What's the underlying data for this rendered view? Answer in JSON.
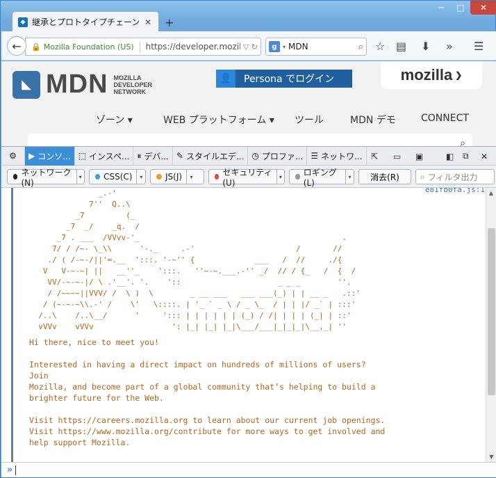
{
  "browser": {
    "tab_title": "継承とプロトタイプチェーン - J...",
    "new_tab": "+",
    "window_min": "─",
    "window_max": "□",
    "window_close": "✕",
    "identity": "Mozilla Foundation (US)",
    "url": "https://developer.mozil",
    "search_engine": "g",
    "search_value": "MDN"
  },
  "page": {
    "logo_text": "MDN",
    "logo_sub": [
      "MOZILLA",
      "DEVELOPER",
      "NETWORK"
    ],
    "persona_label": "Persona でログイン",
    "mozilla_label": "mozilla",
    "menu": [
      "ゾーン ▾",
      "WEB プラットフォーム ▾",
      "ツール",
      "MDN デモ",
      "CONNECT"
    ]
  },
  "devtools": {
    "tabs": [
      {
        "icon": "console-icon",
        "glyph": "▶",
        "label": "コンソ..."
      },
      {
        "icon": "inspector-icon",
        "glyph": "⬚",
        "label": "インスペ..."
      },
      {
        "icon": "debugger-icon",
        "glyph": "⏸",
        "label": "デバ..."
      },
      {
        "icon": "style-editor-icon",
        "glyph": "✎",
        "label": "スタイルエデ..."
      },
      {
        "icon": "profiler-icon",
        "glyph": "◷",
        "label": "プロファ..."
      },
      {
        "icon": "network-icon",
        "glyph": "☰",
        "label": "ネットワ..."
      }
    ],
    "filters": [
      {
        "label": "ネットワーク(N)",
        "color": "#222222"
      },
      {
        "label": "CSS(C)",
        "color": "#3aa0e0"
      },
      {
        "label": "JS(J)",
        "color": "#f0a020"
      },
      {
        "label": "セキュリティ(U)",
        "color": "#e04545"
      },
      {
        "label": "ロギング(L)",
        "color": "#999999"
      }
    ],
    "clear_label": "消去(R)",
    "filter_placeholder": "フィルタ出力"
  },
  "console": {
    "source_link": "e81fb0fa.js:1",
    "ascii_art": [
      "               _.-'",
      "             7''  Q..\\",
      "          _7         (_",
      "        _7  _/    _q.  /",
      "      _7 . ___  /VVvv-'_                                            .",
      "     7/ / /~- \\_\\\\      '-._     .-'                      /       //",
      "    ./ ( /-~-/||'=.__  ':::. '-~'' {             ___   /  //     ./{",
      "   V   V-~-~| ||   __''_    ':::.   ''~-~.___.-'' _/  // / {_   /  {  /",
      "    VV/-~-~-|/ \\ .'__'. '.    '::                     _ _ _        ''.",
      "    / /~~~~||VVV/ /  \\ )  \\        _ __ ___   ___ ___(_) | | __ _   .::'",
      "   / (~-~-~\\\\.-' /    \\'   \\::::. | '_ ` _ \\ / _ \\_  / | | |/ _` | :::'",
      "  /..\\    /..\\__/      '     '::: | | | | | | (_) / /| | | | (_| | ::'",
      "  vVVv    vVVv                 ': |_| |_| |_|\\___/___|_|_|_|\\__,_| ''"
    ],
    "messages": [
      "Hi there, nice to meet you!",
      "",
      "Interested in having a direct impact on hundreds of millions of users?",
      "Join",
      "Mozilla, and become part of a global community that’s helping to build a",
      "brighter future for the Web.",
      "",
      "Visit https://careers.mozilla.org to learn about our current job openings.",
      "Visit https://www.mozilla.org/contribute for more ways to get involved and",
      "help support Mozilla."
    ],
    "prompt": "»"
  }
}
